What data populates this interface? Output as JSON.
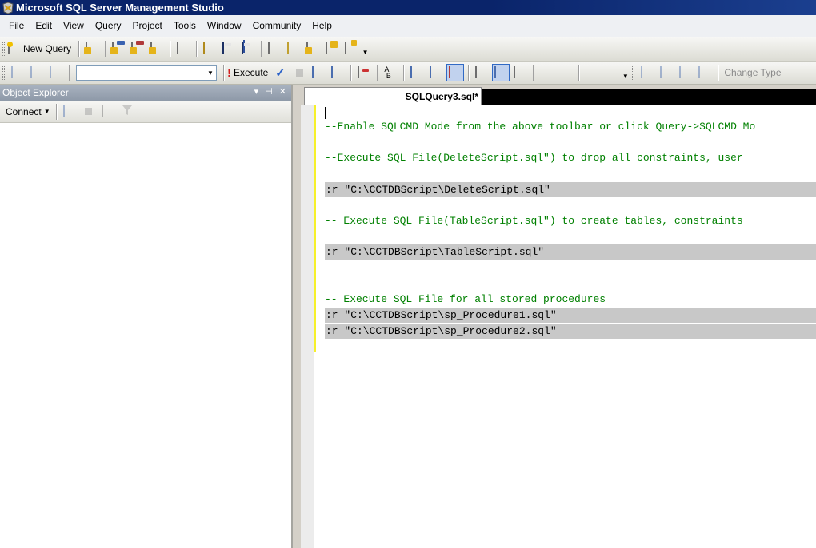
{
  "window": {
    "title": "Microsoft SQL Server Management Studio"
  },
  "menu": [
    "File",
    "Edit",
    "View",
    "Query",
    "Project",
    "Tools",
    "Window",
    "Community",
    "Help"
  ],
  "toolbar1": {
    "new_query": "New Query"
  },
  "toolbar2": {
    "database_selector": "",
    "execute": "Execute",
    "change_type": "Change Type"
  },
  "object_explorer": {
    "title": "Object Explorer",
    "connect": "Connect"
  },
  "editor": {
    "tab_title": "SQLQuery3.sql*",
    "lines": [
      "--Enable SQLCMD Mode from the above toolbar or click Query->SQLCMD Mo",
      "--Execute SQL File(DeleteScript.sql\") to drop all constraints, user",
      ":r \"C:\\CCTDBScript\\DeleteScript.sql\"",
      "-- Execute SQL File(TableScript.sql\") to create tables, constraints",
      ":r \"C:\\CCTDBScript\\TableScript.sql\"",
      "-- Execute SQL File for all stored procedures",
      ":r \"C:\\CCTDBScript\\sp_Procedure1.sql\"",
      ":r \"C:\\CCTDBScript\\sp_Procedure2.sql\""
    ]
  },
  "colors": {
    "comment": "#008000",
    "sqlcmd_highlight": "#c8c8c8",
    "title_bar": "#0a246a",
    "change_marker": "#f6f02a"
  }
}
